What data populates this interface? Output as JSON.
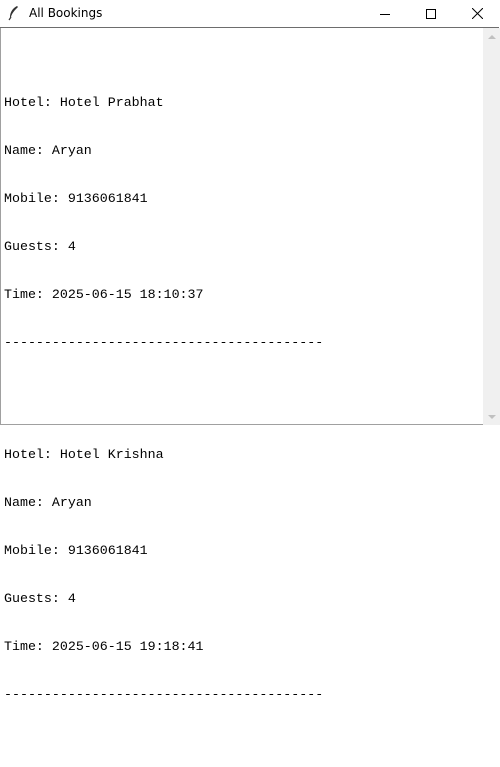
{
  "window": {
    "title": "All Bookings",
    "icon": "feather-icon",
    "controls": [
      "minimize-icon",
      "maximize-icon",
      "close-icon"
    ]
  },
  "bookings": [
    {
      "hotel": "Hotel: Hotel Prabhat",
      "name": "Name: Aryan",
      "mobile": "Mobile: 9136061841",
      "guests": "Guests: 4",
      "time": "Time: 2025-06-15 18:10:37",
      "separator": "----------------------------------------"
    },
    {
      "hotel": "Hotel: Hotel Krishna",
      "name": "Name: Aryan",
      "mobile": "Mobile: 9136061841",
      "guests": "Guests: 4",
      "time": "Time: 2025-06-15 19:18:41",
      "separator": "----------------------------------------"
    }
  ]
}
